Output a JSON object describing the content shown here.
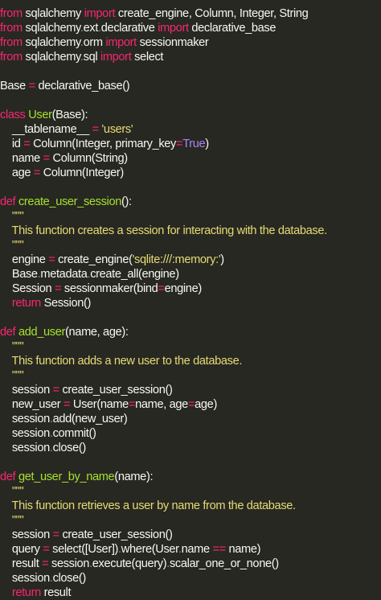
{
  "editor": {
    "theme_colors": {
      "background": "#272822",
      "keyword": "#f92672",
      "function": "#a6e22e",
      "string": "#e6db74",
      "constant": "#ae81ff",
      "text": "#f8f8f2"
    },
    "lines": [
      [
        [
          "kw",
          "from"
        ],
        [
          "txt",
          " sqlalchemy "
        ],
        [
          "kw",
          "import"
        ],
        [
          "txt",
          " create_engine, Column, Integer, String"
        ]
      ],
      [
        [
          "kw",
          "from"
        ],
        [
          "txt",
          " sqlalchemy"
        ],
        [
          "dot",
          "."
        ],
        [
          "txt",
          "ext"
        ],
        [
          "dot",
          "."
        ],
        [
          "txt",
          "declarative "
        ],
        [
          "kw",
          "import"
        ],
        [
          "txt",
          " declarative_base"
        ]
      ],
      [
        [
          "kw",
          "from"
        ],
        [
          "txt",
          " sqlalchemy"
        ],
        [
          "dot",
          "."
        ],
        [
          "txt",
          "orm "
        ],
        [
          "kw",
          "import"
        ],
        [
          "txt",
          " sessionmaker"
        ]
      ],
      [
        [
          "kw",
          "from"
        ],
        [
          "txt",
          " sqlalchemy"
        ],
        [
          "dot",
          "."
        ],
        [
          "txt",
          "sql "
        ],
        [
          "kw",
          "import"
        ],
        [
          "txt",
          " select"
        ]
      ],
      [],
      [
        [
          "txt",
          "Base "
        ],
        [
          "op",
          "="
        ],
        [
          "txt",
          " declarative_base()"
        ]
      ],
      [],
      [
        [
          "kw",
          "class"
        ],
        [
          "txt",
          " "
        ],
        [
          "fn",
          "User"
        ],
        [
          "txt",
          "(Base):"
        ]
      ],
      [
        [
          "txt",
          "    __tablename__ "
        ],
        [
          "op",
          "="
        ],
        [
          "txt",
          " "
        ],
        [
          "str",
          "'users'"
        ]
      ],
      [
        [
          "txt",
          "    id "
        ],
        [
          "op",
          "="
        ],
        [
          "txt",
          " Column(Integer, primary_key"
        ],
        [
          "op",
          "="
        ],
        [
          "bool",
          "True"
        ],
        [
          "txt",
          ")"
        ]
      ],
      [
        [
          "txt",
          "    name "
        ],
        [
          "op",
          "="
        ],
        [
          "txt",
          " Column(String)"
        ]
      ],
      [
        [
          "txt",
          "    age "
        ],
        [
          "op",
          "="
        ],
        [
          "txt",
          " Column(Integer)"
        ]
      ],
      [],
      [
        [
          "kw",
          "def"
        ],
        [
          "txt",
          " "
        ],
        [
          "fn",
          "create_user_session"
        ],
        [
          "txt",
          "():"
        ]
      ],
      [
        [
          "doc",
          "    \"\"\""
        ]
      ],
      [
        [
          "doc",
          "    This function creates a session for interacting with the database."
        ]
      ],
      [
        [
          "doc",
          "    \"\"\""
        ]
      ],
      [
        [
          "txt",
          "    engine "
        ],
        [
          "op",
          "="
        ],
        [
          "txt",
          " create_engine("
        ],
        [
          "str",
          "'sqlite:///:memory:'"
        ],
        [
          "txt",
          ")"
        ]
      ],
      [
        [
          "txt",
          "    Base"
        ],
        [
          "dot",
          "."
        ],
        [
          "txt",
          "metadata"
        ],
        [
          "dot",
          "."
        ],
        [
          "txt",
          "create_all(engine)"
        ]
      ],
      [
        [
          "txt",
          "    Session "
        ],
        [
          "op",
          "="
        ],
        [
          "txt",
          " sessionmaker(bind"
        ],
        [
          "op",
          "="
        ],
        [
          "txt",
          "engine)"
        ]
      ],
      [
        [
          "txt",
          "    "
        ],
        [
          "kw",
          "return"
        ],
        [
          "txt",
          " Session()"
        ]
      ],
      [],
      [
        [
          "kw",
          "def"
        ],
        [
          "txt",
          " "
        ],
        [
          "fn",
          "add_user"
        ],
        [
          "txt",
          "(name, age):"
        ]
      ],
      [
        [
          "doc",
          "    \"\"\""
        ]
      ],
      [
        [
          "doc",
          "    This function adds a new user to the database."
        ]
      ],
      [
        [
          "doc",
          "    \"\"\""
        ]
      ],
      [
        [
          "txt",
          "    session "
        ],
        [
          "op",
          "="
        ],
        [
          "txt",
          " create_user_session()"
        ]
      ],
      [
        [
          "txt",
          "    new_user "
        ],
        [
          "op",
          "="
        ],
        [
          "txt",
          " User(name"
        ],
        [
          "op",
          "="
        ],
        [
          "txt",
          "name, age"
        ],
        [
          "op",
          "="
        ],
        [
          "txt",
          "age)"
        ]
      ],
      [
        [
          "txt",
          "    session"
        ],
        [
          "dot",
          "."
        ],
        [
          "txt",
          "add(new_user)"
        ]
      ],
      [
        [
          "txt",
          "    session"
        ],
        [
          "dot",
          "."
        ],
        [
          "txt",
          "commit()"
        ]
      ],
      [
        [
          "txt",
          "    session"
        ],
        [
          "dot",
          "."
        ],
        [
          "txt",
          "close()"
        ]
      ],
      [],
      [
        [
          "kw",
          "def"
        ],
        [
          "txt",
          " "
        ],
        [
          "fn",
          "get_user_by_name"
        ],
        [
          "txt",
          "(name):"
        ]
      ],
      [
        [
          "doc",
          "    \"\"\""
        ]
      ],
      [
        [
          "doc",
          "    This function retrieves a user by name from the database."
        ]
      ],
      [
        [
          "doc",
          "    \"\"\""
        ]
      ],
      [
        [
          "txt",
          "    session "
        ],
        [
          "op",
          "="
        ],
        [
          "txt",
          " create_user_session()"
        ]
      ],
      [
        [
          "txt",
          "    query "
        ],
        [
          "op",
          "="
        ],
        [
          "txt",
          " select([User])"
        ],
        [
          "dot",
          "."
        ],
        [
          "txt",
          "where(User"
        ],
        [
          "dot",
          "."
        ],
        [
          "txt",
          "name "
        ],
        [
          "op",
          "=="
        ],
        [
          "txt",
          " name)"
        ]
      ],
      [
        [
          "txt",
          "    result "
        ],
        [
          "op",
          "="
        ],
        [
          "txt",
          " session"
        ],
        [
          "dot",
          "."
        ],
        [
          "txt",
          "execute(query)"
        ],
        [
          "dot",
          "."
        ],
        [
          "txt",
          "scalar_one_or_none()"
        ]
      ],
      [
        [
          "txt",
          "    session"
        ],
        [
          "dot",
          "."
        ],
        [
          "txt",
          "close()"
        ]
      ],
      [
        [
          "txt",
          "    "
        ],
        [
          "kw",
          "return"
        ],
        [
          "txt",
          " result"
        ]
      ]
    ]
  }
}
